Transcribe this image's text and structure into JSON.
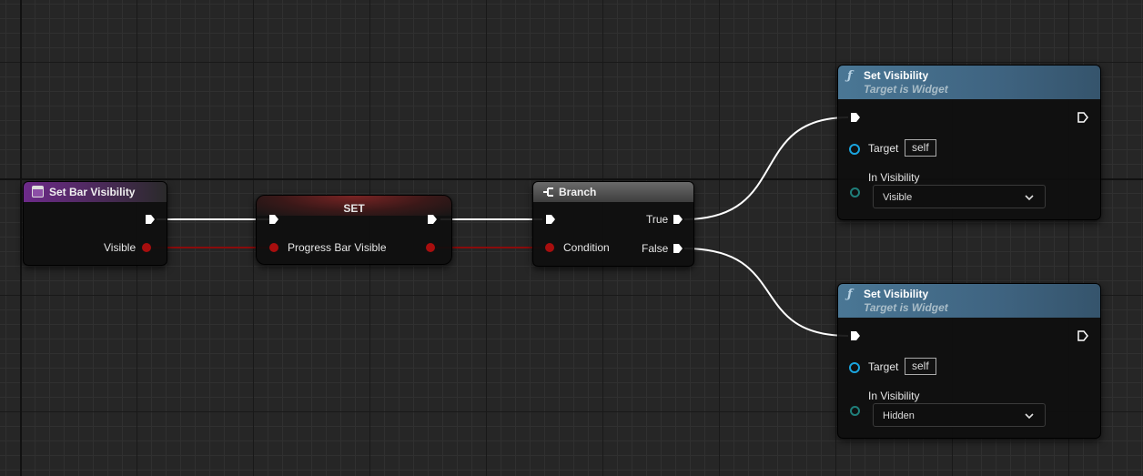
{
  "nodes": {
    "event": {
      "title": "Set Bar Visibility",
      "output_pin": "Visible"
    },
    "set": {
      "title": "SET",
      "input_pin": "Progress Bar Visible"
    },
    "branch": {
      "title": "Branch",
      "condition_pin": "Condition",
      "true_pin": "True",
      "false_pin": "False"
    },
    "set_visibility_1": {
      "title": "Set Visibility",
      "subtitle": "Target is Widget",
      "target_label": "Target",
      "target_value": "self",
      "visibility_label": "In Visibility",
      "visibility_value": "Visible"
    },
    "set_visibility_2": {
      "title": "Set Visibility",
      "subtitle": "Target is Widget",
      "target_label": "Target",
      "target_value": "self",
      "visibility_label": "In Visibility",
      "visibility_value": "Hidden"
    }
  },
  "colors": {
    "exec_wire": "#ffffff",
    "bool_wire": "#8a0b0b",
    "event_header": "#6d2a8a",
    "function_header": "#4a7795",
    "object_pin": "#1aa4de"
  },
  "icons": {
    "function": "function-icon",
    "event": "event-icon",
    "branch": "branch-icon",
    "exec": "exec-pin-icon",
    "dropdown": "chevron-down-icon"
  }
}
